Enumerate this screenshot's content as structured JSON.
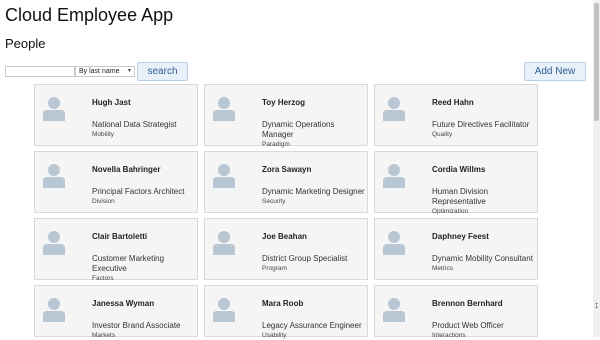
{
  "app_title": "Cloud Employee App",
  "page_title": "People",
  "search": {
    "value": "",
    "placeholder": ""
  },
  "sort": {
    "selected": "By last name"
  },
  "buttons": {
    "search": "search",
    "add_new": "Add New"
  },
  "employees": [
    {
      "name": "Hugh Jast",
      "title": "National Data Strategist",
      "dept": "Mobility"
    },
    {
      "name": "Toy Herzog",
      "title": "Dynamic Operations Manager",
      "dept": "Paradigm"
    },
    {
      "name": "Reed Hahn",
      "title": "Future Directives Facilitator",
      "dept": "Quality"
    },
    {
      "name": "Novella Bahringer",
      "title": "Principal Factors Architect",
      "dept": "Division"
    },
    {
      "name": "Zora Sawayn",
      "title": "Dynamic Marketing Designer",
      "dept": "Security"
    },
    {
      "name": "Cordia Willms",
      "title": "Human Division Representative",
      "dept": "Optimization"
    },
    {
      "name": "Clair Bartoletti",
      "title": "Customer Marketing Executive",
      "dept": "Factors"
    },
    {
      "name": "Joe Beahan",
      "title": "District Group Specialist",
      "dept": "Program"
    },
    {
      "name": "Daphney Feest",
      "title": "Dynamic Mobility Consultant",
      "dept": "Metrics"
    },
    {
      "name": "Janessa Wyman",
      "title": "Investor Brand Associate",
      "dept": "Markets"
    },
    {
      "name": "Mara Roob",
      "title": "Legacy Assurance Engineer",
      "dept": "Usability"
    },
    {
      "name": "Brennon Bernhard",
      "title": "Product Web Officer",
      "dept": "Interactions"
    }
  ],
  "icons": {
    "avatar": "person-silhouette-icon",
    "caret": "caret-down-icon",
    "cursor": "resize-cursor-icon"
  },
  "colors": {
    "button_text": "#2d5f8f",
    "button_bg": "#e8f1fa",
    "card_bg": "#f5f5f5",
    "avatar": "#b9c6d3"
  }
}
